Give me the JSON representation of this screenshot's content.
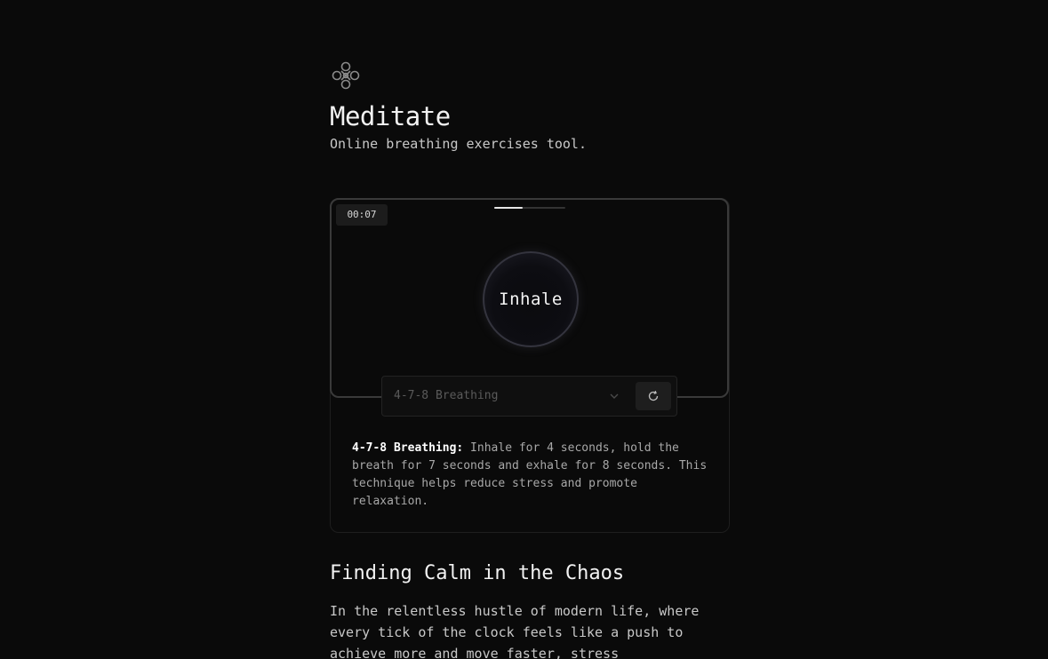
{
  "app": {
    "title": "Meditate",
    "subtitle": "Online breathing exercises tool."
  },
  "logo": {
    "icon": "knot-logo-icon"
  },
  "exercise": {
    "timer": "00:07",
    "phase": "Inhale",
    "progress_fraction": 0.4,
    "selected_technique": "4-7-8 Breathing",
    "reset_icon": "refresh-icon",
    "chevron_icon": "chevron-down-icon"
  },
  "description": {
    "name": "4-7-8 Breathing:",
    "text": " Inhale for 4 seconds, hold the breath for 7 seconds and exhale for 8 seconds. This technique helps reduce stress and promote relaxation."
  },
  "article": {
    "heading": "Finding Calm in the Chaos",
    "body": "In the relentless hustle of modern life, where every tick of the clock feels like a push to achieve more and move faster, stress"
  },
  "colors": {
    "background": "#0a0a0a",
    "text": "#f2f2f2",
    "muted": "#a8a8a8",
    "border": "#3a3a3a"
  }
}
